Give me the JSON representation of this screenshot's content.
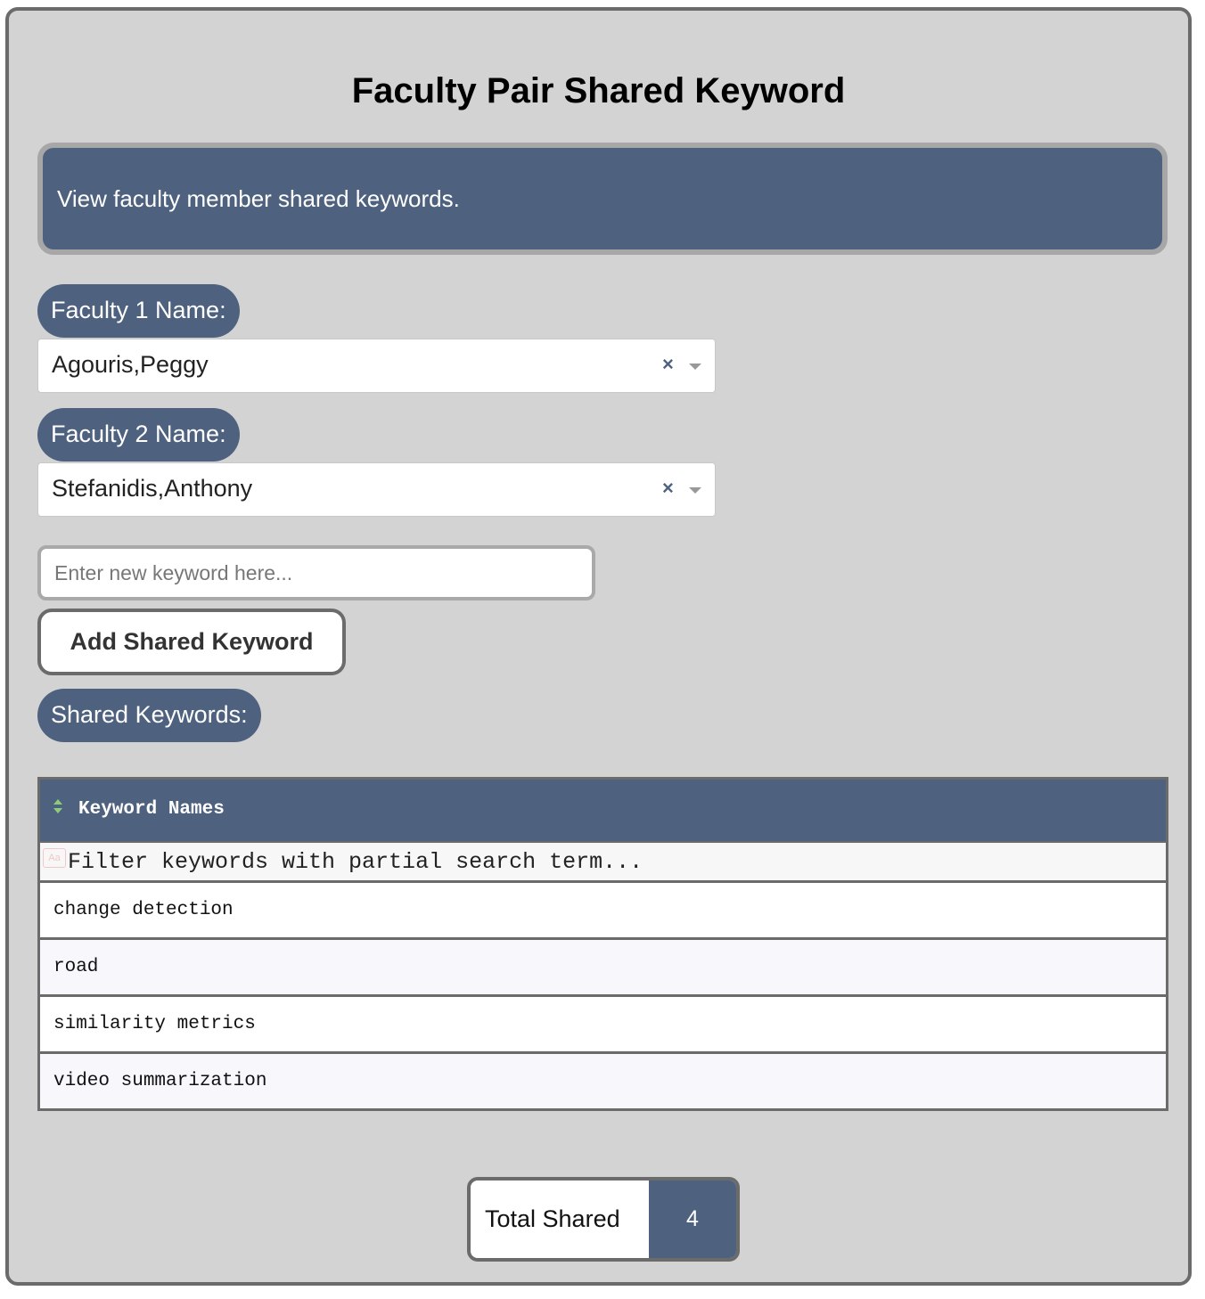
{
  "page": {
    "title": "Faculty Pair Shared Keyword",
    "description": "View faculty member shared keywords."
  },
  "faculty1": {
    "label": "Faculty 1 Name:",
    "selected": "Agouris,Peggy"
  },
  "faculty2": {
    "label": "Faculty 2 Name:",
    "selected": "Stefanidis,Anthony"
  },
  "new_keyword": {
    "placeholder": "Enter new keyword here...",
    "value": ""
  },
  "add_button": {
    "label": "Add Shared Keyword"
  },
  "shared_section": {
    "label": "Shared Keywords:"
  },
  "table": {
    "header": "Keyword Names",
    "filter_placeholder": "Filter keywords with partial search term...",
    "filter_icon": "Aa",
    "rows": [
      "change detection",
      "road",
      "similarity metrics",
      "video summarization"
    ]
  },
  "total": {
    "label": "Total Shared",
    "value": "4"
  },
  "icons": {
    "clear": "×",
    "sort": "sort-icon",
    "dropdown": "chevron-down-icon"
  },
  "colors": {
    "accent": "#4e627f",
    "panel_bg": "#d3d3d3",
    "border": "#6b6b6b",
    "sort_icon": "#8fcc7a"
  }
}
